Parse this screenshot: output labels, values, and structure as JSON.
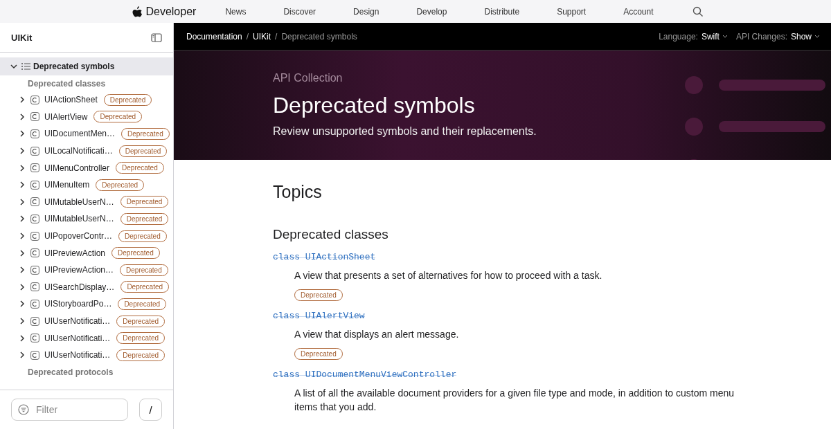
{
  "global_nav": {
    "brand": "Developer",
    "links": [
      "News",
      "Discover",
      "Design",
      "Develop",
      "Distribute",
      "Support",
      "Account"
    ]
  },
  "sidebar": {
    "title": "UIKit",
    "root": {
      "label": "Deprecated symbols",
      "expanded": true,
      "selected": true
    },
    "sections": [
      {
        "heading": "Deprecated classes",
        "items": [
          {
            "label": "UIActionSheet",
            "badge": "Deprecated",
            "expanded": false
          },
          {
            "label": "UIAlertView",
            "badge": "Deprecated",
            "expanded": false
          },
          {
            "label": "UIDocumentMen…",
            "badge": "Deprecated",
            "expanded": false
          },
          {
            "label": "UILocalNotificati…",
            "badge": "Deprecated",
            "expanded": false
          },
          {
            "label": "UIMenuController",
            "badge": "Deprecated",
            "expanded": false
          },
          {
            "label": "UIMenuItem",
            "badge": "Deprecated",
            "expanded": false
          },
          {
            "label": "UIMutableUserN…",
            "badge": "Deprecated",
            "expanded": false
          },
          {
            "label": "UIMutableUserN…",
            "badge": "Deprecated",
            "expanded": false
          },
          {
            "label": "UIPopoverContr…",
            "badge": "Deprecated",
            "expanded": false
          },
          {
            "label": "UIPreviewAction",
            "badge": "Deprecated",
            "expanded": false
          },
          {
            "label": "UIPreviewAction…",
            "badge": "Deprecated",
            "expanded": false
          },
          {
            "label": "UISearchDisplay…",
            "badge": "Deprecated",
            "expanded": false
          },
          {
            "label": "UIStoryboardPo…",
            "badge": "Deprecated",
            "expanded": false
          },
          {
            "label": "UIUserNotificati…",
            "badge": "Deprecated",
            "expanded": false
          },
          {
            "label": "UIUserNotificati…",
            "badge": "Deprecated",
            "expanded": false
          },
          {
            "label": "UIUserNotificati…",
            "badge": "Deprecated",
            "expanded": false
          }
        ]
      },
      {
        "heading": "Deprecated protocols"
      }
    ],
    "filter": {
      "placeholder": "Filter"
    },
    "shortcut_key": "/"
  },
  "breadcrumbs": [
    {
      "label": "Documentation",
      "current": false
    },
    {
      "separator": "/",
      "label": "UIKit",
      "current": false
    },
    {
      "separator": "/",
      "label": "Deprecated symbols",
      "current": true
    }
  ],
  "options": [
    {
      "label": "Language:",
      "value": "Swift"
    },
    {
      "label": "API Changes:",
      "value": "Show"
    }
  ],
  "hero": {
    "eyebrow": "API Collection",
    "title": "Deprecated symbols",
    "abstract": "Review unsupported symbols and their replacements."
  },
  "topics": {
    "heading": "Topics",
    "groups": [
      {
        "heading": "Deprecated classes",
        "symbols": [
          {
            "keyword": "class",
            "name": "UIActionSheet",
            "deprecated": true,
            "abstract": "A view that presents a set of alternatives for how to proceed with a task.",
            "badge": "Deprecated"
          },
          {
            "keyword": "class",
            "name": "UIAlertView",
            "deprecated": true,
            "abstract": "A view that displays an alert message.",
            "badge": "Deprecated"
          },
          {
            "keyword": "class",
            "name": "UIDocumentMenuViewController",
            "deprecated": true,
            "abstract": "A list of all the available document providers for a given file type and mode, in addition to custom menu items that you add."
          }
        ]
      }
    ]
  }
}
